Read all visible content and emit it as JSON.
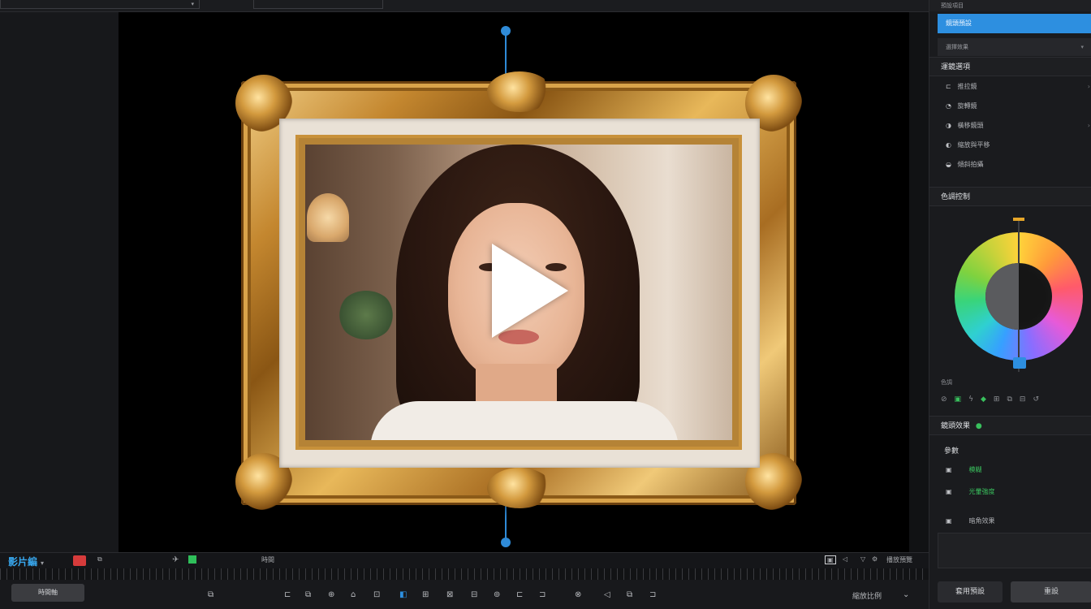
{
  "topbar": {
    "field1": "",
    "field2": "",
    "field1_caret": "▾"
  },
  "right_panel": {
    "top_label": "預設項目",
    "selected_preset": "鏡頭預設",
    "dropdown_value": "選擇效果",
    "section1_title": "運鏡選項",
    "section1_rows": [
      {
        "icon": "⊏",
        "label": "推拉鏡"
      },
      {
        "icon": "◔",
        "label": "旋轉鏡"
      },
      {
        "icon": "◑",
        "label": "橫移鏡頭"
      },
      {
        "icon": "◐",
        "label": "縮放與平移"
      },
      {
        "icon": "◒",
        "label": "傾斜拍攝"
      }
    ],
    "section2_title": "色調控制",
    "wheel_label": "色調",
    "section3_title": "鏡頭效果",
    "section3_sub": "參數",
    "section3_rows": [
      {
        "icon": "▣",
        "label": "模糊",
        "color": "#39c05d"
      },
      {
        "icon": "▣",
        "label": "光暈強度",
        "color": "#39c05d"
      },
      {
        "icon": "▣",
        "label": "暗角效果",
        "color": "#aeb0b4"
      }
    ],
    "btn_apply": "套用預設",
    "btn_reset": "重設"
  },
  "transport": {
    "brand": "影片編",
    "brand_caret": "▾",
    "label_mid": "時間",
    "label_right": "播放預覽"
  },
  "timeline": {
    "left_button": "時間軸",
    "right_label": "縮放比例"
  },
  "colors": {
    "accent": "#2d8fe0",
    "record": "#d63b3b",
    "green": "#39c05d",
    "gold": "#c4872f"
  }
}
